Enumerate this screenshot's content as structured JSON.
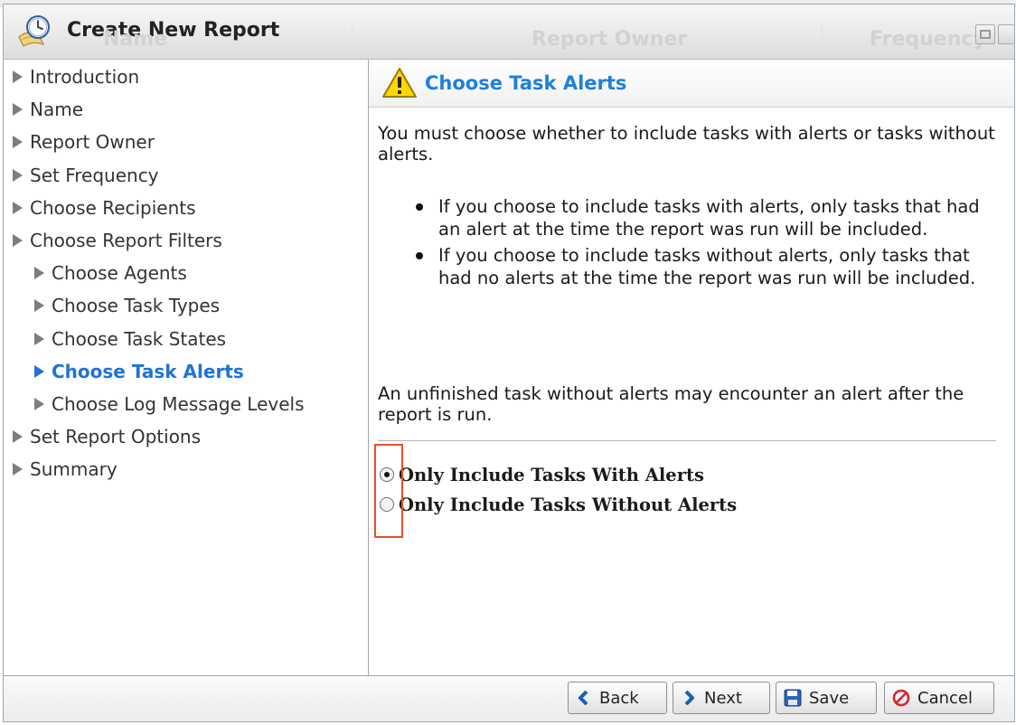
{
  "dialog": {
    "title": "Create New Report",
    "background_tabs": [
      "Name",
      "Report Owner",
      "Frequency"
    ]
  },
  "nav": {
    "items": [
      {
        "label": "Introduction",
        "level": 0,
        "active": false
      },
      {
        "label": "Name",
        "level": 0,
        "active": false
      },
      {
        "label": "Report Owner",
        "level": 0,
        "active": false
      },
      {
        "label": "Set Frequency",
        "level": 0,
        "active": false
      },
      {
        "label": "Choose Recipients",
        "level": 0,
        "active": false
      },
      {
        "label": "Choose Report Filters",
        "level": 0,
        "active": false
      },
      {
        "label": "Choose Agents",
        "level": 1,
        "active": false
      },
      {
        "label": "Choose Task Types",
        "level": 1,
        "active": false
      },
      {
        "label": "Choose Task States",
        "level": 1,
        "active": false
      },
      {
        "label": "Choose Task Alerts",
        "level": 1,
        "active": true
      },
      {
        "label": "Choose Log Message Levels",
        "level": 1,
        "active": false
      },
      {
        "label": "Set Report Options",
        "level": 0,
        "active": false
      },
      {
        "label": "Summary",
        "level": 0,
        "active": false
      }
    ]
  },
  "content": {
    "title": "Choose Task Alerts",
    "intro": "You must choose whether to include tasks with alerts or tasks without alerts.",
    "bullets": [
      "If you choose to include tasks with alerts, only tasks that had an alert at the time the report was run will be included.",
      "If you choose to include tasks without alerts, only tasks that had no alerts at the time the report was run will be included."
    ],
    "note": "An unfinished task without alerts may encounter an alert after the report is run.",
    "options": [
      {
        "label": "Only Include Tasks With Alerts",
        "checked": true
      },
      {
        "label": "Only Include Tasks Without Alerts",
        "checked": false
      }
    ]
  },
  "footer": {
    "back": "Back",
    "next": "Next",
    "save": "Save",
    "cancel": "Cancel"
  },
  "colors": {
    "accent": "#1e80dd",
    "highlight": "#e8502a",
    "cancel_icon": "#d9262c",
    "nav_arrow": "#1e73d8"
  },
  "icons": {
    "title": "report-clock-icon",
    "step": "warning-icon",
    "back": "chevron-left-icon",
    "next": "chevron-right-icon",
    "save": "floppy-disk-icon",
    "cancel": "cancel-circle-icon"
  }
}
